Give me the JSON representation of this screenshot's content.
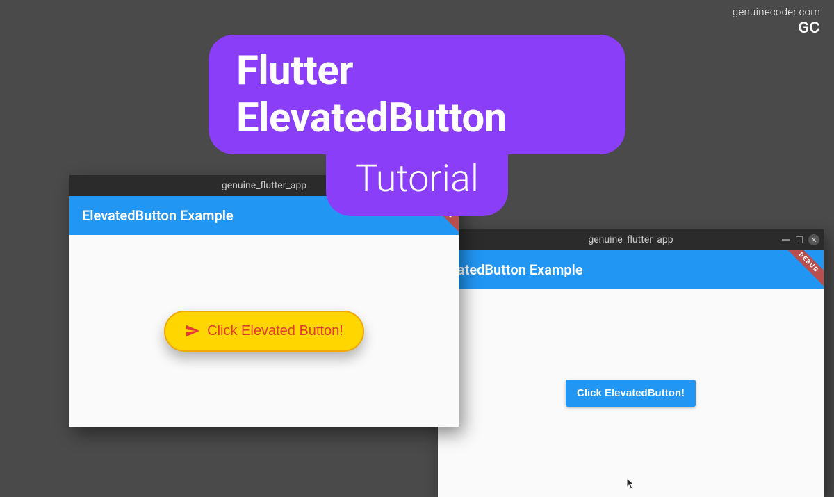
{
  "watermark": {
    "url": "genuinecoder.com",
    "logo": "GC"
  },
  "title": {
    "line1": "Flutter ElevatedButton",
    "line2": "Tutorial"
  },
  "window_left": {
    "titlebar": "genuine_flutter_app",
    "appbar_title": "ElevatedButton Example",
    "debug_label": "DEBUG",
    "button_label": "Click Elevated Button!"
  },
  "window_right": {
    "titlebar": "genuine_flutter_app",
    "appbar_title": "vatedButton Example",
    "debug_label": "DEBUG",
    "button_label": "Click ElevatedButton!",
    "close_symbol": "✕"
  }
}
